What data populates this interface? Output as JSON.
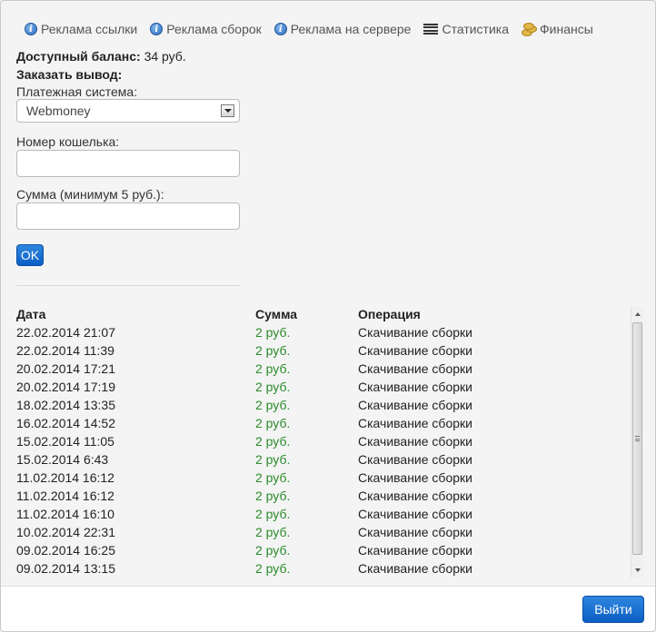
{
  "nav": {
    "items": [
      {
        "label": "Реклама ссылки",
        "icon": "info-icon"
      },
      {
        "label": "Реклама сборок",
        "icon": "info-icon"
      },
      {
        "label": "Реклама на сервере",
        "icon": "info-icon"
      },
      {
        "label": "Статистика",
        "icon": "list-icon"
      },
      {
        "label": "Финансы",
        "icon": "coins-icon"
      }
    ]
  },
  "balance": {
    "label": "Доступный баланс:",
    "value": "34 руб."
  },
  "order": {
    "title": "Заказать вывод:",
    "payment_label": "Платежная система:",
    "payment_value": "Webmoney",
    "wallet_label": "Номер кошелька:",
    "wallet_value": "",
    "amount_label": "Сумма (минимум 5 руб.):",
    "amount_value": "",
    "ok_label": "OK"
  },
  "table": {
    "headers": [
      "Дата",
      "Сумма",
      "Операция"
    ],
    "rows": [
      [
        "22.02.2014 21:07",
        "2 руб.",
        "Скачивание сборки"
      ],
      [
        "22.02.2014 11:39",
        "2 руб.",
        "Скачивание сборки"
      ],
      [
        "20.02.2014 17:21",
        "2 руб.",
        "Скачивание сборки"
      ],
      [
        "20.02.2014 17:19",
        "2 руб.",
        "Скачивание сборки"
      ],
      [
        "18.02.2014 13:35",
        "2 руб.",
        "Скачивание сборки"
      ],
      [
        "16.02.2014 14:52",
        "2 руб.",
        "Скачивание сборки"
      ],
      [
        "15.02.2014 11:05",
        "2 руб.",
        "Скачивание сборки"
      ],
      [
        "15.02.2014 6:43",
        "2 руб.",
        "Скачивание сборки"
      ],
      [
        "11.02.2014 16:12",
        "2 руб.",
        "Скачивание сборки"
      ],
      [
        "11.02.2014 16:12",
        "2 руб.",
        "Скачивание сборки"
      ],
      [
        "11.02.2014 16:10",
        "2 руб.",
        "Скачивание сборки"
      ],
      [
        "10.02.2014 22:31",
        "2 руб.",
        "Скачивание сборки"
      ],
      [
        "09.02.2014 16:25",
        "2 руб.",
        "Скачивание сборки"
      ],
      [
        "09.02.2014 13:15",
        "2 руб.",
        "Скачивание сборки"
      ]
    ]
  },
  "footer": {
    "exit_label": "Выйти"
  },
  "colors": {
    "accent": "#0b5fc4",
    "amount_green": "#2a8a2a"
  }
}
